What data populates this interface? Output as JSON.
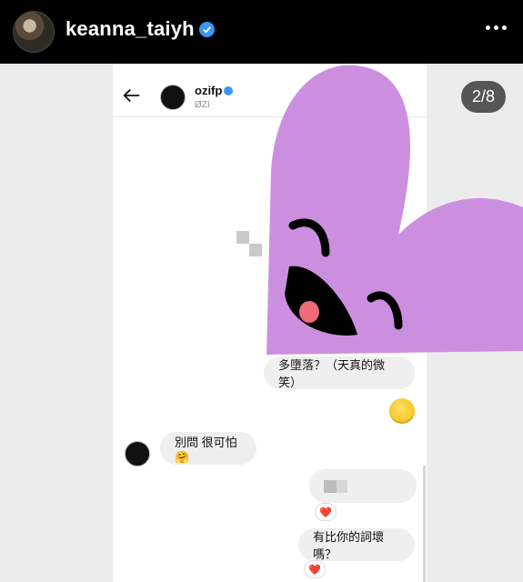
{
  "post_header": {
    "username": "keanna_taiyh",
    "verified_icon": "verified-badge-icon",
    "more_icon": "more-options-icon"
  },
  "carousel": {
    "counter": "2/8"
  },
  "dm": {
    "contact_name": "ozifp",
    "contact_sub": "ØZI",
    "verified_icon": "verified-badge-icon",
    "back_icon": "back-arrow-icon"
  },
  "messages": [
    {
      "text": "多墮落？（天真的微笑）",
      "side": "right"
    },
    {
      "text": "🙂",
      "side": "right",
      "kind": "emoji"
    },
    {
      "text": "別問 很可怕🤗",
      "side": "left"
    },
    {
      "text": "",
      "side": "right",
      "kind": "censored"
    },
    {
      "reaction": "❤️"
    },
    {
      "text": "有比你的詞壞嗎？",
      "side": "right"
    },
    {
      "reaction": "❤️"
    }
  ],
  "sticker": {
    "name": "purple-heart-face-sticker",
    "color": "#cc8fdf"
  },
  "colors": {
    "topbar": "#000000",
    "bubble": "#efefef",
    "verified": "#3897f0",
    "sticker": "#cc8fdf"
  }
}
